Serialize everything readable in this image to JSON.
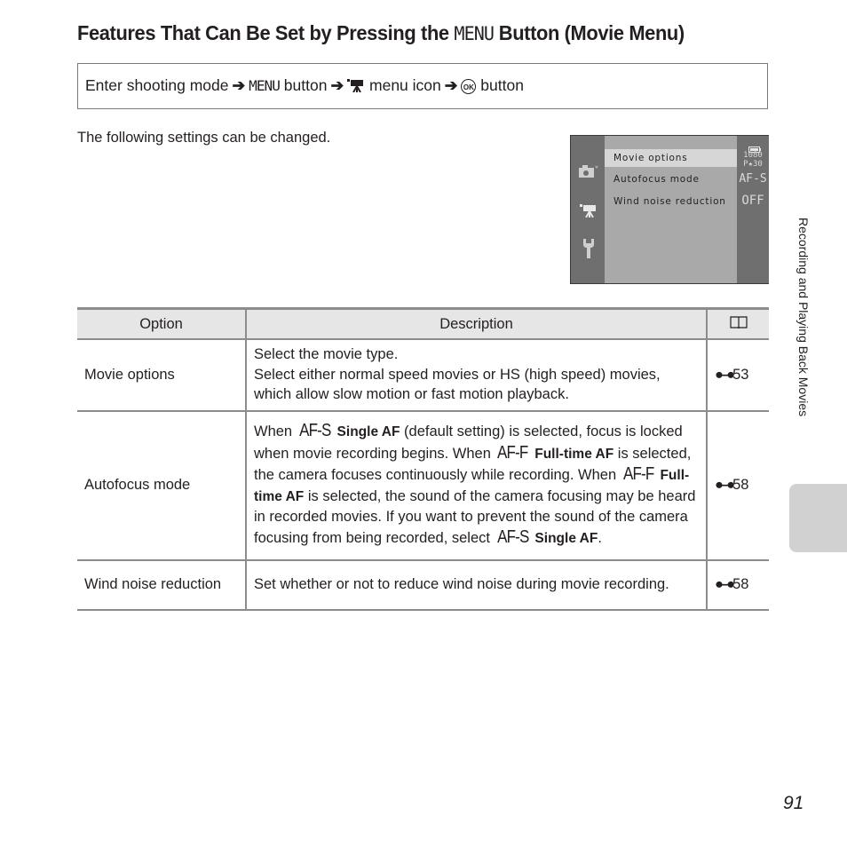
{
  "title": {
    "before": "Features That Can Be Set by Pressing the ",
    "menu_glyph": "MENU",
    "after": " Button (Movie Menu)"
  },
  "nav": {
    "step1": "Enter shooting mode",
    "arrow": "➔",
    "step2_glyph": "MENU",
    "step2": " button",
    "step3_icon": "movie-camera-icon",
    "step3": " menu icon",
    "step4_glyph": "OK",
    "step4": " button"
  },
  "intro": "The following settings can be changed.",
  "camera_screen": {
    "items": [
      {
        "label": "Movie options",
        "value": "1080 P★30",
        "selected": true
      },
      {
        "label": "Autofocus mode",
        "value": "AF-S",
        "selected": false
      },
      {
        "label": "Wind noise reduction",
        "value": "OFF",
        "selected": false
      }
    ],
    "tabs": [
      "camera-icon",
      "movie-camera-icon",
      "wrench-icon"
    ],
    "battery_icon": "battery-icon"
  },
  "table": {
    "headers": {
      "option": "Option",
      "description": "Description",
      "ref_icon": "book-icon"
    },
    "rows": [
      {
        "option": "Movie options",
        "desc_line1": "Select the movie type.",
        "desc_line2": "Select either normal speed movies or HS (high speed) movies, which allow slow motion or fast motion playback.",
        "ref_glyph": "o-o",
        "ref": "53"
      },
      {
        "option": "Autofocus mode",
        "p1": "When ",
        "g1": "AF-S",
        "b1": " Single AF",
        "p2": " (default setting) is selected, focus is locked when movie recording begins. When ",
        "g2": "AF-F",
        "b2": " Full-time AF",
        "p3": " is selected, the camera focuses continuously while recording. When ",
        "g3": "AF-F",
        "b3": " Full-time AF",
        "p4": " is selected, the sound of the camera focusing may be heard in recorded movies. If you want to prevent the sound of the camera focusing from being recorded, select ",
        "g4": "AF-S",
        "b4": " Single AF",
        "p5": ".",
        "ref_glyph": "o-o",
        "ref": "58"
      },
      {
        "option": "Wind noise reduction",
        "desc": "Set whether or not to reduce wind noise during movie recording.",
        "ref_glyph": "o-o",
        "ref": "58"
      }
    ]
  },
  "side_label": "Recording and Playing Back Movies",
  "page_number": "91"
}
